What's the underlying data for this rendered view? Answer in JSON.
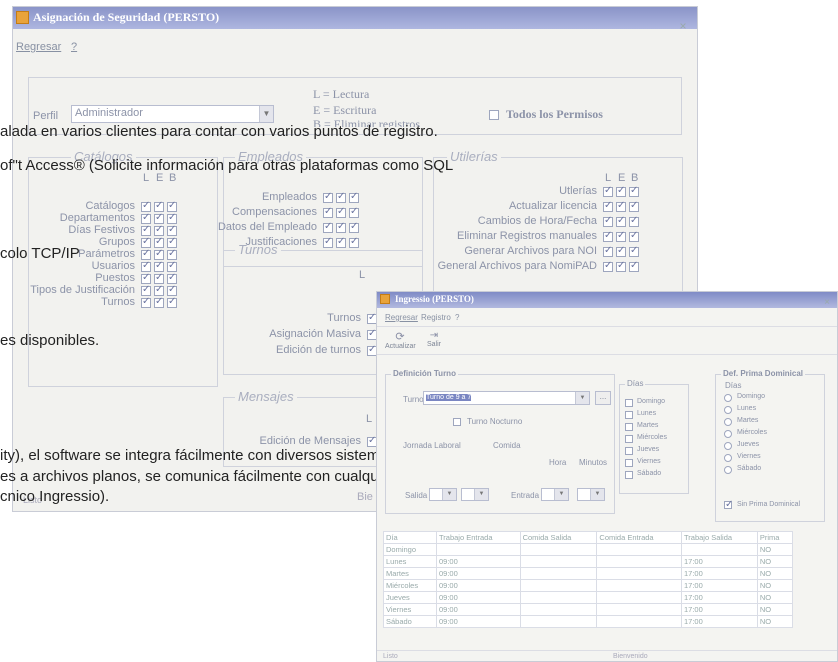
{
  "win1": {
    "title": "Asignación de Seguridad  (PERSTO)",
    "menu": [
      "Regresar",
      "?"
    ],
    "perfil_label": "Perfil",
    "perfil_value": "Administrador",
    "legend": [
      "L = Lectura",
      "E = Escritura",
      "B = Eliminar registros"
    ],
    "todos_label": "Todos  los Permisos",
    "headers": [
      "L",
      "E",
      "B"
    ],
    "catalogos": {
      "title": "Catálogos",
      "items": [
        "Catálogos",
        "Departamentos",
        "Días Festivos",
        "Grupos",
        "Parámetros",
        "Usuarios",
        "Puestos",
        "Tipos de Justificación",
        "Turnos"
      ]
    },
    "empleados": {
      "title": "Empleados",
      "items": [
        "Empleados",
        "Compensaciones",
        "Datos del Empleado",
        "Justificaciones"
      ]
    },
    "utilerias": {
      "title": "Utilerías",
      "items": [
        "Utlerías",
        "Actualizar licencia",
        "Cambios de Hora/Fecha",
        "Eliminar Registros manuales",
        "Generar Archivos para NOI",
        "General Archivos para NomiPAD"
      ]
    },
    "turnos": {
      "title": "Turnos",
      "items": [
        "Turnos",
        "Asignación Masiva",
        "Edición de turnos"
      ]
    },
    "mensajes": {
      "title": "Mensajes",
      "items": [
        "Edición de Mensajes"
      ]
    },
    "status_left": "Listo",
    "status_right": "Bie"
  },
  "overlay": [
    "alada en varios clientes para contar con varios puntos de registro.",
    "of\"t Access® (Solicite información para otras plataformas como SQL",
    "colo TCP/IP",
    "es disponibles.",
    "ity), el software se integra fácilmente con diversos  sistemas.",
    "es a archivos planos, se comunica fácilmente con cualquier",
    "cnico Ingressio)."
  ],
  "win2": {
    "title": "Ingressio  (PERSTO)",
    "menu": [
      "Regresar",
      "Registro",
      "?"
    ],
    "toolbar": [
      "Actualizar",
      "Salir"
    ],
    "def_turno": "Definición Turno",
    "turno_label": "Turno",
    "turno_value": "Turno de 9 a 7",
    "turno_nocturno": "Turno Nocturno",
    "dias_title": "Días",
    "dias": [
      "Domingo",
      "Lunes",
      "Martes",
      "Miércoles",
      "Jueves",
      "Viernes",
      "Sábado"
    ],
    "prima_title": "Def. Prima Dominical",
    "prima_dias": "Días",
    "prima_sin": "Sin Prima Dominical",
    "jornada_labels": [
      "Jornada Laboral",
      "Comida",
      "Hora",
      "Minutos"
    ],
    "entrada_label": "Entrada",
    "salida_label": "Salida",
    "table_headers": [
      "Día",
      "Trabajo Entrada",
      "Comida Salida",
      "Comida Entrada",
      "Trabajo Salida",
      "Prima"
    ],
    "rows": [
      [
        "Domingo",
        "",
        "",
        "",
        "",
        "NO"
      ],
      [
        "Lunes",
        "09:00",
        "",
        "",
        "17:00",
        "NO"
      ],
      [
        "Martes",
        "09:00",
        "",
        "",
        "17:00",
        "NO"
      ],
      [
        "Miércoles",
        "09:00",
        "",
        "",
        "17:00",
        "NO"
      ],
      [
        "Jueves",
        "09:00",
        "",
        "",
        "17:00",
        "NO"
      ],
      [
        "Viernes",
        "09:00",
        "",
        "",
        "17:00",
        "NO"
      ],
      [
        "Sábado",
        "09:00",
        "",
        "",
        "17:00",
        "NO"
      ]
    ],
    "status_left": "Listo",
    "status_right": "Bienvenido"
  }
}
